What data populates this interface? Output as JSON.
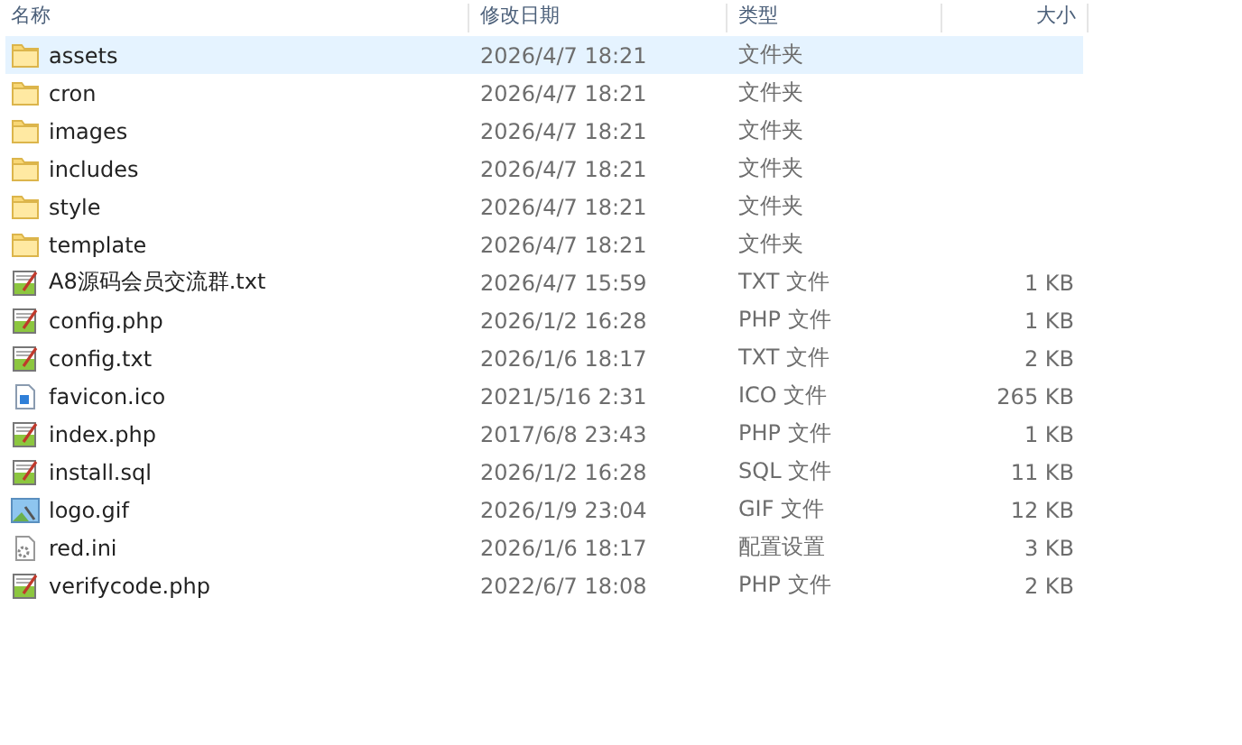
{
  "columns": [
    "名称",
    "修改日期",
    "类型",
    "大小"
  ],
  "files": [
    {
      "kind": "folder",
      "name": "assets",
      "date": "2026/4/7 18:21",
      "type": "文件夹",
      "selected": true
    },
    {
      "kind": "folder",
      "name": "cron",
      "date": "2026/4/7 18:21",
      "type": "文件夹",
      "selected": false
    },
    {
      "kind": "folder",
      "name": "images",
      "date": "2026/4/7 18:21",
      "type": "文件夹",
      "selected": false
    },
    {
      "kind": "folder",
      "name": "includes",
      "date": "2026/4/7 18:21",
      "type": "文件夹",
      "selected": false
    },
    {
      "kind": "folder",
      "name": "style",
      "date": "2026/4/7 18:21",
      "type": "文件夹",
      "selected": false
    },
    {
      "kind": "folder",
      "name": "template",
      "date": "2026/4/7 18:21",
      "type": "文件夹",
      "selected": false
    },
    {
      "kind": "text",
      "name": "A8源码会员交流群.txt",
      "date": "2026/4/7 15:59",
      "type": "TXT 文件",
      "size": "1 KB",
      "selected": false
    },
    {
      "kind": "text",
      "name": "config.php",
      "date": "2026/1/2 16:28",
      "type": "PHP 文件",
      "size": "1 KB",
      "selected": false
    },
    {
      "kind": "text",
      "name": "config.txt",
      "date": "2026/1/6 18:17",
      "type": "TXT 文件",
      "size": "2 KB",
      "selected": false
    },
    {
      "kind": "icon-file",
      "name": "favicon.ico",
      "date": "2021/5/16 2:31",
      "type": "ICO 文件",
      "size": "265 KB",
      "selected": false
    },
    {
      "kind": "text",
      "name": "index.php",
      "date": "2017/6/8 23:43",
      "type": "PHP 文件",
      "size": "1 KB",
      "selected": false
    },
    {
      "kind": "text",
      "name": "install.sql",
      "date": "2026/1/2 16:28",
      "type": "SQL 文件",
      "size": "11 KB",
      "selected": false
    },
    {
      "kind": "image",
      "name": "logo.gif",
      "date": "2026/1/9 23:04",
      "type": "GIF 文件",
      "size": "12 KB",
      "selected": false
    },
    {
      "kind": "settings",
      "name": "red.ini",
      "date": "2026/1/6 18:17",
      "type": "配置设置",
      "size": "3 KB",
      "selected": false
    },
    {
      "kind": "text",
      "name": "verifycode.php",
      "date": "2022/6/7 18:08",
      "type": "PHP 文件",
      "size": "2 KB",
      "selected": false
    }
  ]
}
